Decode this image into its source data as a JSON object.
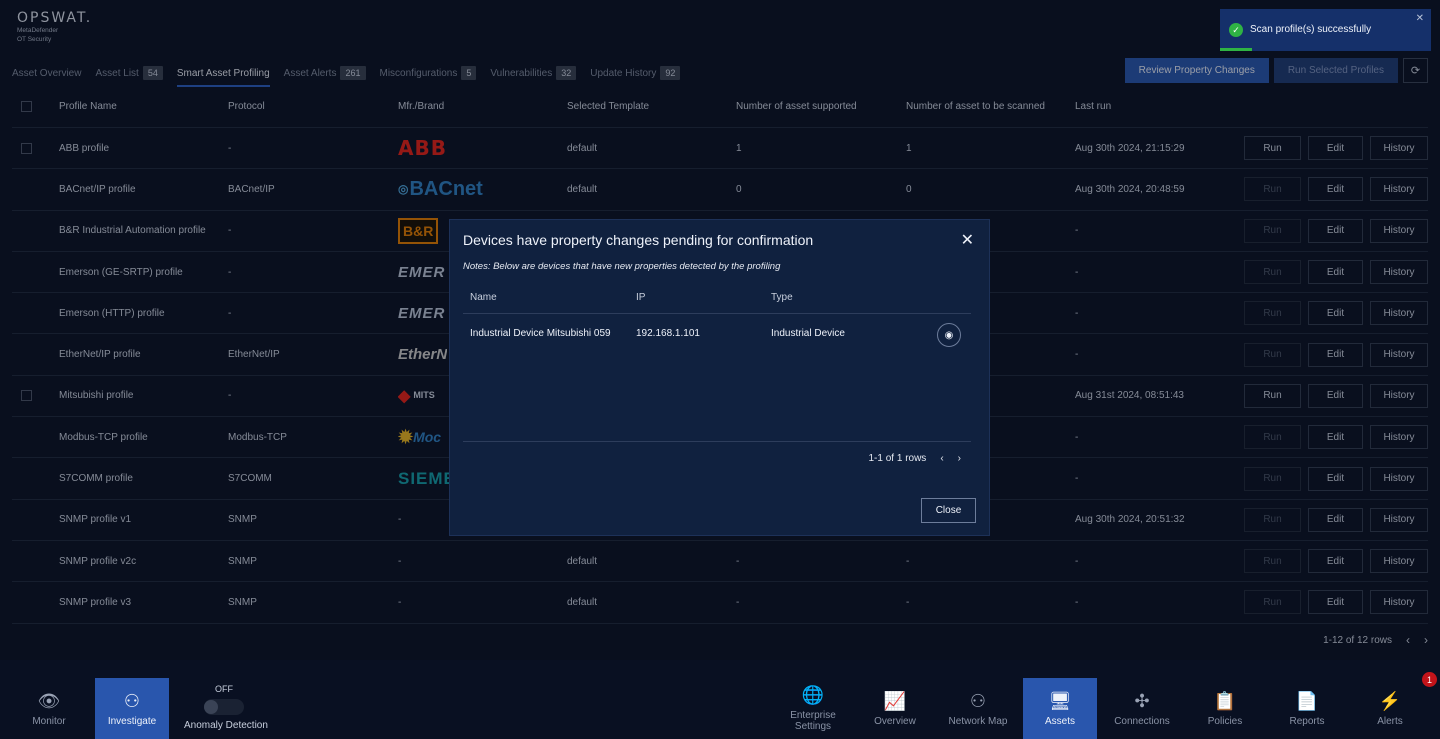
{
  "brand": {
    "logo": "OPSWAT.",
    "line1": "MetaDefender",
    "line2": "OT Security"
  },
  "tabs": [
    {
      "label": "Asset Overview",
      "count": null
    },
    {
      "label": "Asset List",
      "count": "54"
    },
    {
      "label": "Smart Asset Profiling",
      "count": null,
      "active": true
    },
    {
      "label": "Asset Alerts",
      "count": "261"
    },
    {
      "label": "Misconfigurations",
      "count": "5"
    },
    {
      "label": "Vulnerabilities",
      "count": "32"
    },
    {
      "label": "Update History",
      "count": "92"
    }
  ],
  "actions": {
    "review": "Review Property Changes",
    "run_selected": "Run Selected Profiles",
    "refresh_icon": "refresh-icon"
  },
  "columns": {
    "name": "Profile Name",
    "protocol": "Protocol",
    "brand": "Mfr./Brand",
    "template": "Selected Template",
    "supported": "Number of asset supported",
    "scanned": "Number of asset to be scanned",
    "last_run": "Last run"
  },
  "rows": [
    {
      "name": "ABB profile",
      "protocol": "-",
      "brand": "ABB",
      "template": "default",
      "supported": "1",
      "scanned": "1",
      "last_run": "Aug 30th 2024, 21:15:29",
      "checkbox": true,
      "run_enabled": true
    },
    {
      "name": "BACnet/IP profile",
      "protocol": "BACnet/IP",
      "brand": "BACnet",
      "template": "default",
      "supported": "0",
      "scanned": "0",
      "last_run": "Aug 30th 2024, 20:48:59",
      "checkbox": false,
      "run_enabled": false
    },
    {
      "name": "B&R Industrial Automation profile",
      "protocol": "-",
      "brand": "B&R",
      "template": "",
      "supported": "",
      "scanned": "",
      "last_run": "-",
      "checkbox": false,
      "run_enabled": false
    },
    {
      "name": "Emerson (GE-SRTP) profile",
      "protocol": "-",
      "brand": "EMER",
      "template": "",
      "supported": "",
      "scanned": "",
      "last_run": "-",
      "checkbox": false,
      "run_enabled": false
    },
    {
      "name": "Emerson (HTTP) profile",
      "protocol": "-",
      "brand": "EMER",
      "template": "",
      "supported": "",
      "scanned": "",
      "last_run": "-",
      "checkbox": false,
      "run_enabled": false
    },
    {
      "name": "EtherNet/IP profile",
      "protocol": "EtherNet/IP",
      "brand": "EtherN",
      "template": "",
      "supported": "",
      "scanned": "",
      "last_run": "-",
      "checkbox": false,
      "run_enabled": false
    },
    {
      "name": "Mitsubishi profile",
      "protocol": "-",
      "brand": "MITS",
      "template": "",
      "supported": "",
      "scanned": "",
      "last_run": "Aug 31st 2024, 08:51:43",
      "checkbox": true,
      "run_enabled": true
    },
    {
      "name": "Modbus-TCP profile",
      "protocol": "Modbus-TCP",
      "brand": "Moc",
      "template": "",
      "supported": "",
      "scanned": "",
      "last_run": "-",
      "checkbox": false,
      "run_enabled": false
    },
    {
      "name": "S7COMM profile",
      "protocol": "S7COMM",
      "brand": "SIEME",
      "template": "",
      "supported": "",
      "scanned": "",
      "last_run": "-",
      "checkbox": false,
      "run_enabled": false
    },
    {
      "name": "SNMP profile v1",
      "protocol": "SNMP",
      "brand": "-",
      "template": "",
      "supported": "",
      "scanned": "",
      "last_run": "Aug 30th 2024, 20:51:32",
      "checkbox": false,
      "run_enabled": false
    },
    {
      "name": "SNMP profile v2c",
      "protocol": "SNMP",
      "brand": "-",
      "template": "default",
      "supported": "-",
      "scanned": "-",
      "last_run": "-",
      "checkbox": false,
      "run_enabled": false
    },
    {
      "name": "SNMP profile v3",
      "protocol": "SNMP",
      "brand": "-",
      "template": "default",
      "supported": "-",
      "scanned": "-",
      "last_run": "-",
      "checkbox": false,
      "run_enabled": false
    }
  ],
  "row_buttons": {
    "run": "Run",
    "edit": "Edit",
    "history": "History"
  },
  "pager": {
    "text": "1-12 of 12 rows"
  },
  "modal": {
    "title": "Devices have property changes pending for confirmation",
    "note": "Notes: Below are devices that have new properties detected by the profiling",
    "columns": {
      "name": "Name",
      "ip": "IP",
      "type": "Type"
    },
    "rows": [
      {
        "name": "Industrial Device Mitsubishi 059",
        "ip": "192.168.1.101",
        "type": "Industrial Device"
      }
    ],
    "pager": "1-1 of 1 rows",
    "close": "Close"
  },
  "toast": {
    "message": "Scan profile(s) successfully"
  },
  "bottom_nav": {
    "monitor": "Monitor",
    "investigate": "Investigate",
    "anomaly_state": "OFF",
    "anomaly": "Anomaly Detection",
    "enterprise_1": "Enterprise",
    "enterprise_2": "Settings",
    "overview": "Overview",
    "network_map": "Network Map",
    "assets": "Assets",
    "connections": "Connections",
    "policies": "Policies",
    "reports": "Reports",
    "alerts": "Alerts",
    "alerts_badge": "1"
  },
  "colors": {
    "accent": "#2956ad",
    "background": "#0b1326",
    "modal": "#10213f",
    "success": "#2fb344",
    "badge": "#c3141a"
  }
}
